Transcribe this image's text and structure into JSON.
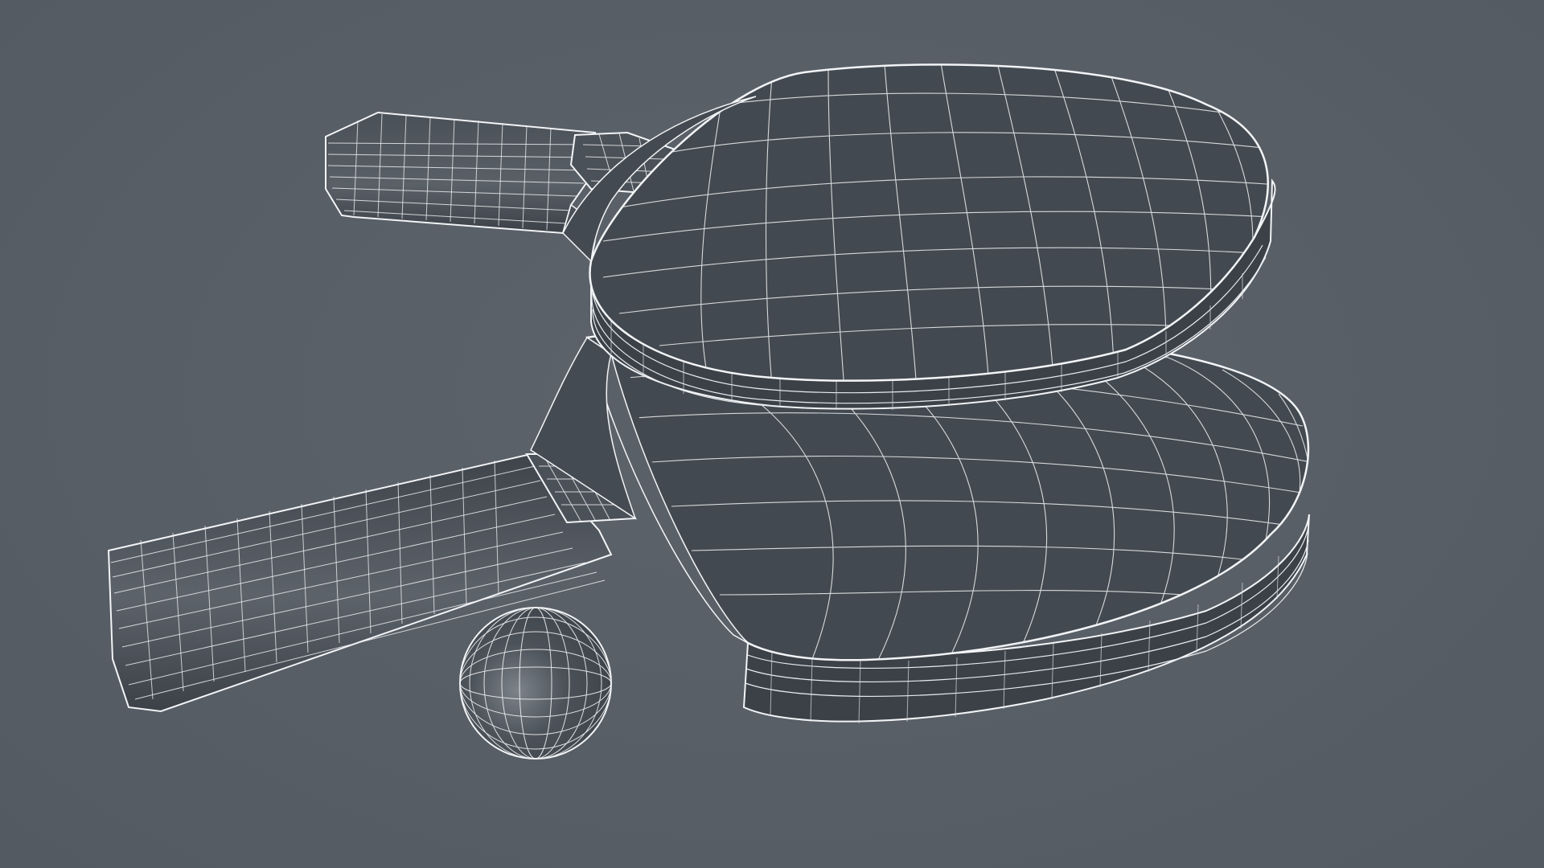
{
  "scene": {
    "background_color": "#595f67",
    "wire_color": "#f2f4f6",
    "surface_color": "#424850",
    "objects": [
      {
        "name": "paddle-top",
        "kind": "table tennis paddle"
      },
      {
        "name": "paddle-bottom",
        "kind": "table tennis paddle"
      },
      {
        "name": "ball",
        "kind": "table tennis ball"
      }
    ]
  }
}
